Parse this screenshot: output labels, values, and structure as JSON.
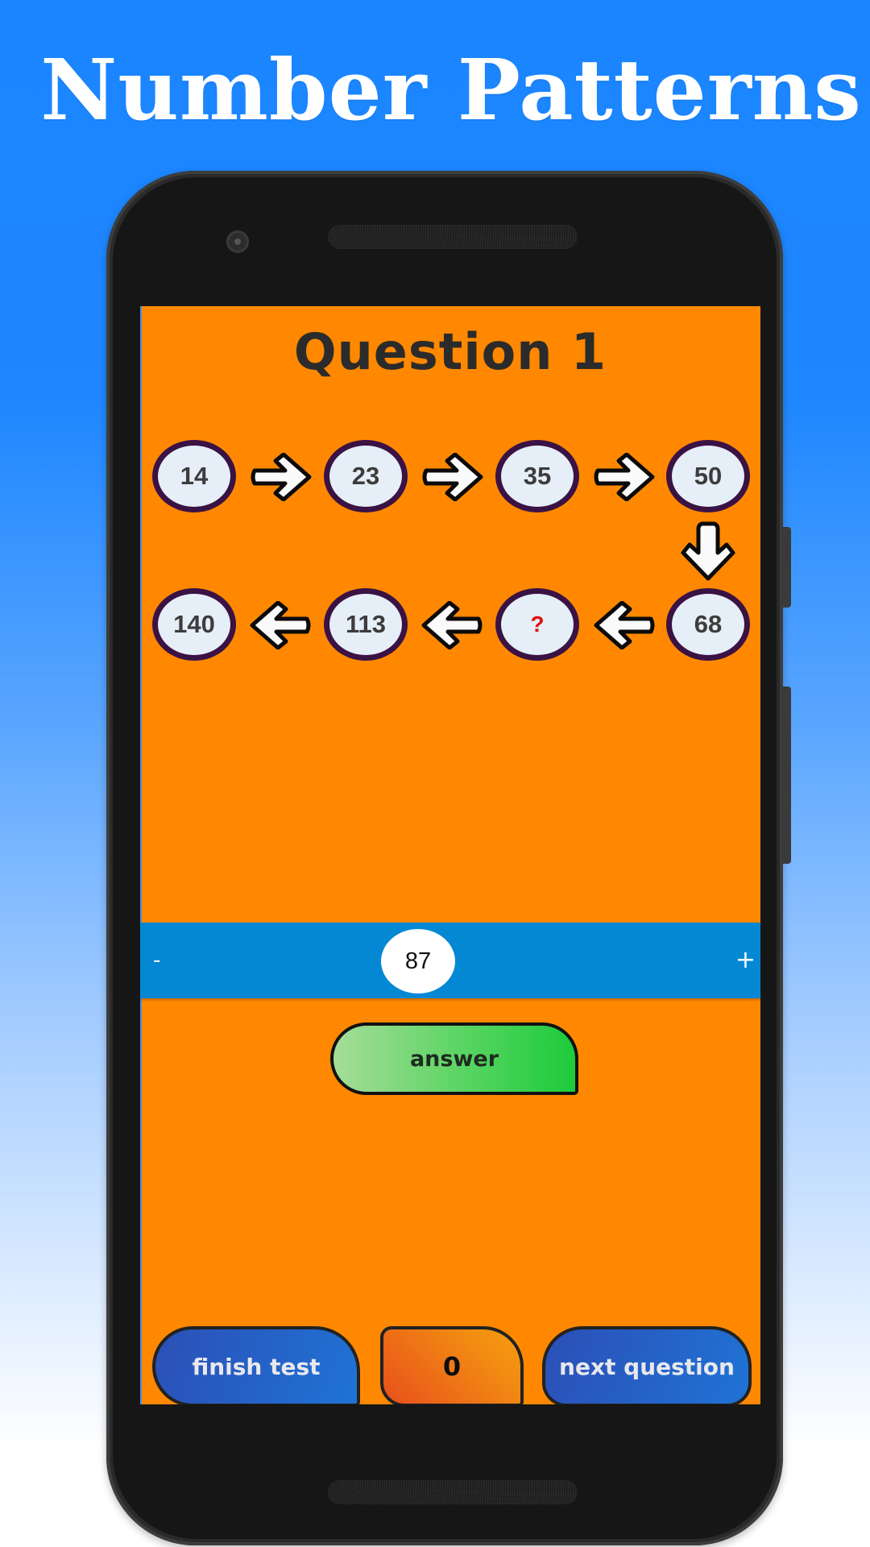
{
  "promo": {
    "title": "Number Patterns"
  },
  "screen": {
    "question_title": "Question 1",
    "sequence": [
      {
        "value": "14"
      },
      {
        "value": "23"
      },
      {
        "value": "35"
      },
      {
        "value": "50"
      },
      {
        "value": "68"
      },
      {
        "value": "?"
      },
      {
        "value": "113"
      },
      {
        "value": "140"
      }
    ],
    "stepper": {
      "minus_label": "-",
      "plus_label": "+",
      "value": "87"
    },
    "answer_label": "answer",
    "bottom": {
      "finish_label": "finish test",
      "score": "0",
      "next_label": "next question"
    }
  },
  "colors": {
    "background_top": "#1a85ff",
    "screen_bg": "#ff8800",
    "stepper_bg": "#0588d4",
    "node_border": "#3a1244",
    "unknown_text": "#e01010"
  }
}
